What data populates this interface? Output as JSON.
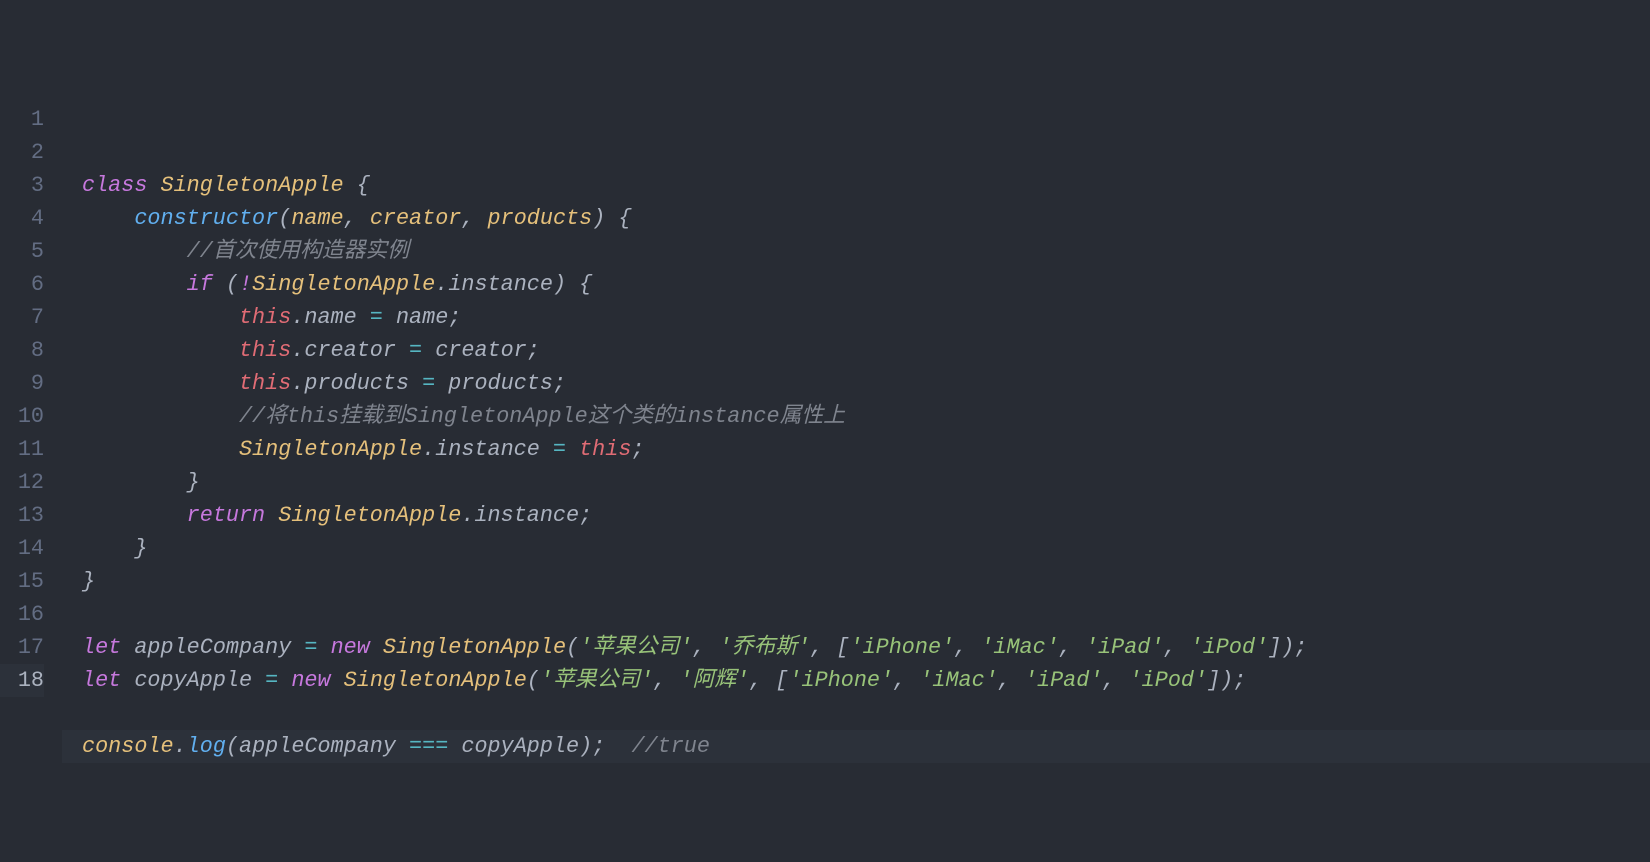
{
  "lineNumbers": [
    "1",
    "2",
    "3",
    "4",
    "5",
    "6",
    "7",
    "8",
    "9",
    "10",
    "11",
    "12",
    "13",
    "14",
    "15",
    "16",
    "17",
    "18"
  ],
  "activeLine": 18,
  "code": {
    "l1": {
      "kw_class": "class",
      "sp": " ",
      "ClassName": "SingletonApple",
      "brace": " {"
    },
    "l2": {
      "indent": "    ",
      "ctor": "constructor",
      "lp": "(",
      "name": "name",
      "c1": ", ",
      "creator": "creator",
      "c2": ", ",
      "products": "products",
      "rp": ") {"
    },
    "l3": {
      "indent": "        ",
      "comment": "//首次使用构造器实例"
    },
    "l4": {
      "indent": "        ",
      "kw_if": "if",
      "sp": " (",
      "bang": "!",
      "cls": "SingletonApple",
      "dot": ".",
      "inst": "instance",
      "rp": ") {"
    },
    "l5": {
      "indent": "            ",
      "this": "this",
      "dot": ".",
      "prop": "name",
      "eq": " = ",
      "val": "name",
      "semi": ";"
    },
    "l6": {
      "indent": "            ",
      "this": "this",
      "dot": ".",
      "prop": "creator",
      "eq": " = ",
      "val": "creator",
      "semi": ";"
    },
    "l7": {
      "indent": "            ",
      "this": "this",
      "dot": ".",
      "prop": "products",
      "eq": " = ",
      "val": "products",
      "semi": ";"
    },
    "l8": {
      "indent": "            ",
      "comment": "//将this挂载到SingletonApple这个类的instance属性上"
    },
    "l9": {
      "indent": "            ",
      "cls": "SingletonApple",
      "dot": ".",
      "inst": "instance",
      "eq": " = ",
      "this": "this",
      "semi": ";"
    },
    "l10": {
      "indent": "        ",
      "brace": "}"
    },
    "l11": {
      "indent": "        ",
      "kw_return": "return",
      "sp": " ",
      "cls": "SingletonApple",
      "dot": ".",
      "inst": "instance",
      "semi": ";"
    },
    "l12": {
      "indent": "    ",
      "brace": "}"
    },
    "l13": {
      "brace": "}"
    },
    "l14": {
      "blank": ""
    },
    "l15": {
      "kw_let": "let",
      "sp": " ",
      "var": "appleCompany",
      "eq": " = ",
      "kw_new": "new",
      "sp2": " ",
      "cls": "SingletonApple",
      "lp": "(",
      "s1": "'苹果公司'",
      "c1": ", ",
      "s2": "'乔布斯'",
      "c2": ", ",
      "lb": "[",
      "a1": "'iPhone'",
      "ac1": ", ",
      "a2": "'iMac'",
      "ac2": ", ",
      "a3": "'iPad'",
      "ac3": ", ",
      "a4": "'iPod'",
      "rb": "]",
      "rp": ");"
    },
    "l16": {
      "kw_let": "let",
      "sp": " ",
      "var": "copyApple",
      "eq": " = ",
      "kw_new": "new",
      "sp2": " ",
      "cls": "SingletonApple",
      "lp": "(",
      "s1": "'苹果公司'",
      "c1": ", ",
      "s2": "'阿辉'",
      "c2": ", ",
      "lb": "[",
      "a1": "'iPhone'",
      "ac1": ", ",
      "a2": "'iMac'",
      "ac2": ", ",
      "a3": "'iPad'",
      "ac3": ", ",
      "a4": "'iPod'",
      "rb": "]",
      "rp": ");"
    },
    "l17": {
      "blank": ""
    },
    "l18": {
      "console": "console",
      "dot": ".",
      "log": "log",
      "lp": "(",
      "a": "appleCompany",
      "eq": " === ",
      "b": "copyApple",
      "rp": ");",
      "pad": "  ",
      "comment": "//true"
    }
  }
}
